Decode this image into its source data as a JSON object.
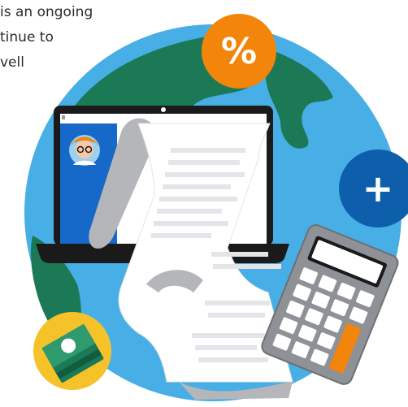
{
  "caption": {
    "lines": [
      "is an ongoing",
      "tinue to",
      "vell"
    ]
  },
  "badges": {
    "percent": {
      "symbol": "%",
      "color": "#f2850a"
    },
    "plus": {
      "symbol": "+",
      "color": "#0d5fab"
    },
    "money": {
      "icon": "money-stack-icon",
      "color": "#f5c22a"
    }
  },
  "colors": {
    "ocean": "#48aee6",
    "land": "#1b7a55",
    "laptop_frame": "#1a1a1a",
    "screen_panel": "#1668c9",
    "receipt": "#ffffff",
    "calculator": "#8e9196",
    "calculator_key_accent": "#f2850a"
  },
  "icons": [
    "globe-icon",
    "laptop-icon",
    "avatar-icon",
    "receipt-icon",
    "calculator-icon",
    "percent-icon",
    "plus-icon",
    "money-stack-icon"
  ]
}
